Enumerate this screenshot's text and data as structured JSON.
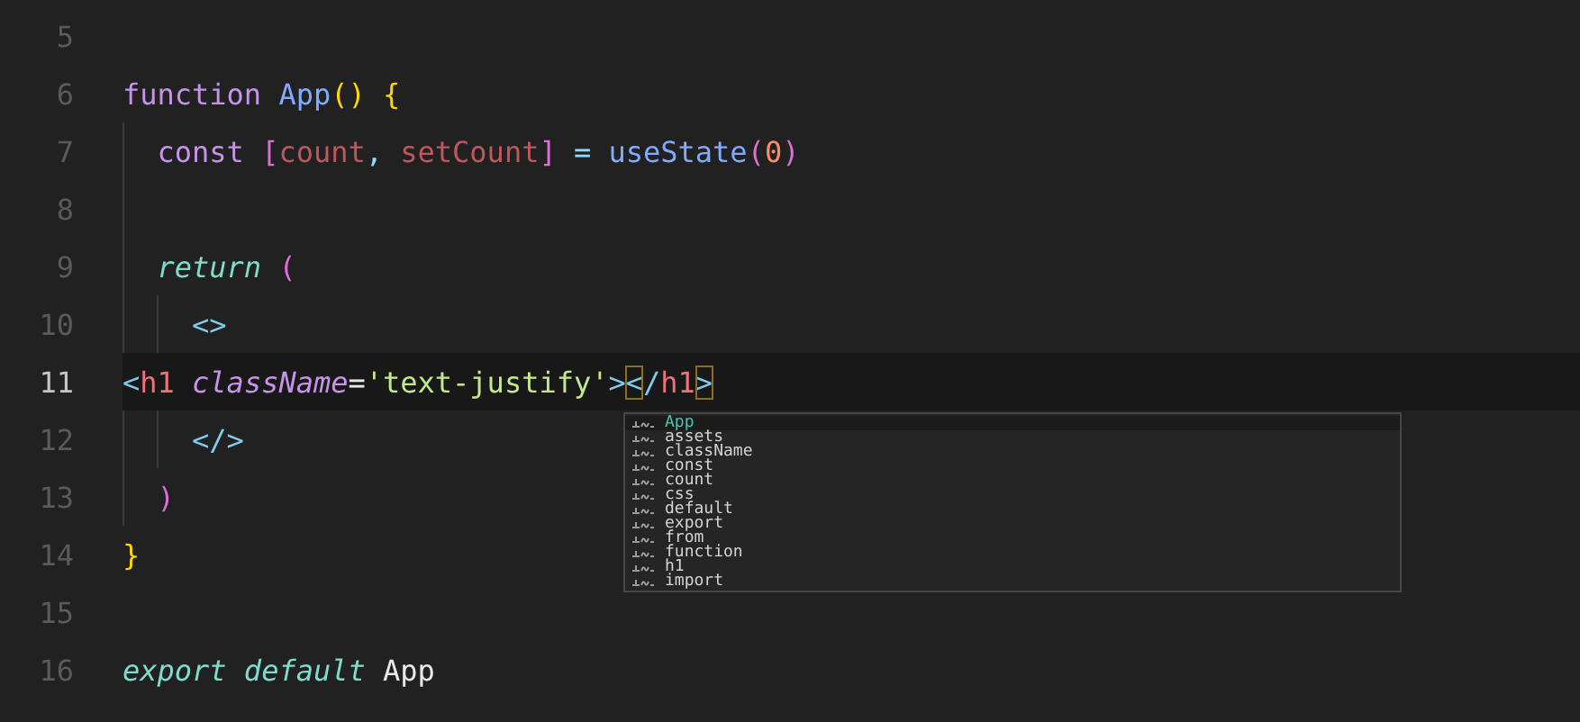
{
  "editor": {
    "lines": [
      {
        "number": "5",
        "current": false
      },
      {
        "number": "6",
        "current": false,
        "tokens": [
          {
            "text": "function ",
            "kind": "keyword"
          },
          {
            "text": "App",
            "kind": "func"
          },
          {
            "text": "()",
            "kind": "bracket"
          },
          {
            "text": " {",
            "kind": "bracket"
          }
        ]
      },
      {
        "number": "7",
        "current": false,
        "tokens": [
          {
            "text": "  const ",
            "kind": "keyword"
          },
          {
            "text": "[",
            "kind": "bracket2"
          },
          {
            "text": "count",
            "kind": "var"
          },
          {
            "text": ", ",
            "kind": "punct"
          },
          {
            "text": "setCount",
            "kind": "var"
          },
          {
            "text": "]",
            "kind": "bracket2"
          },
          {
            "text": " = ",
            "kind": "punct"
          },
          {
            "text": "useState",
            "kind": "func"
          },
          {
            "text": "(",
            "kind": "bracket2"
          },
          {
            "text": "0",
            "kind": "number"
          },
          {
            "text": ")",
            "kind": "bracket2"
          }
        ]
      },
      {
        "number": "8",
        "current": false
      },
      {
        "number": "9",
        "current": false,
        "tokens": [
          {
            "text": "  return",
            "kind": "control"
          },
          {
            "text": " (",
            "kind": "bracket2"
          }
        ]
      },
      {
        "number": "10",
        "current": false,
        "tokens": [
          {
            "text": "    <>",
            "kind": "tagpunct"
          }
        ]
      },
      {
        "number": "11",
        "current": true,
        "tokens": [
          {
            "text": "<",
            "kind": "tagpunct"
          },
          {
            "text": "h1",
            "kind": "tag"
          },
          {
            "text": " className",
            "kind": "attr"
          },
          {
            "text": "=",
            "kind": "plain"
          },
          {
            "text": "'text-justify'",
            "kind": "string"
          },
          {
            "text": ">",
            "kind": "tagpunct"
          },
          {
            "text": "<",
            "kind": "tagpunct",
            "matched": true
          },
          {
            "text": "/",
            "kind": "tagpunct"
          },
          {
            "text": "h1",
            "kind": "tag"
          },
          {
            "text": ">",
            "kind": "tagpunct",
            "matched": true
          }
        ]
      },
      {
        "number": "12",
        "current": false,
        "tokens": [
          {
            "text": "    </>",
            "kind": "tagpunct"
          }
        ]
      },
      {
        "number": "13",
        "current": false,
        "tokens": [
          {
            "text": "  )",
            "kind": "bracket2"
          }
        ]
      },
      {
        "number": "14",
        "current": false,
        "tokens": [
          {
            "text": "}",
            "kind": "bracket"
          }
        ]
      },
      {
        "number": "15",
        "current": false
      },
      {
        "number": "16",
        "current": false,
        "tokens": [
          {
            "text": "export default",
            "kind": "control"
          },
          {
            "text": " App",
            "kind": "plain"
          }
        ]
      }
    ]
  },
  "suggestions": [
    {
      "label": "App",
      "selected": true
    },
    {
      "label": "assets",
      "selected": false
    },
    {
      "label": "className",
      "selected": false
    },
    {
      "label": "const",
      "selected": false
    },
    {
      "label": "count",
      "selected": false
    },
    {
      "label": "css",
      "selected": false
    },
    {
      "label": "default",
      "selected": false
    },
    {
      "label": "export",
      "selected": false
    },
    {
      "label": "from",
      "selected": false
    },
    {
      "label": "function",
      "selected": false
    },
    {
      "label": "h1",
      "selected": false
    },
    {
      "label": "import",
      "selected": false
    }
  ]
}
